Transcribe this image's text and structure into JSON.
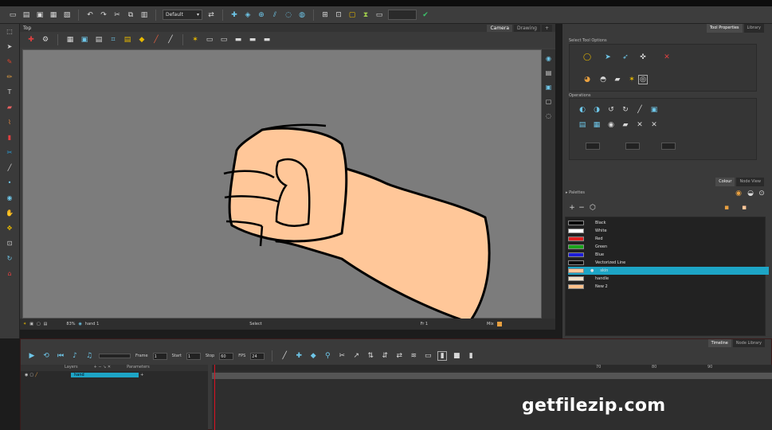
{
  "window": {
    "view_title": "Top",
    "view_tabs": [
      "Camera",
      "Drawing"
    ],
    "toolbar_preset": "Default"
  },
  "statusbar": {
    "zoom": "83%",
    "layer": "hand 1",
    "tool": "Select",
    "frame": "Fr 1",
    "mode": "Mix"
  },
  "tool_properties": {
    "tabs": [
      "Tool Properties",
      "Library"
    ],
    "select_options_label": "Select Tool Options",
    "operations_label": "Operations"
  },
  "colour": {
    "tabs": [
      "Colour",
      "Node View"
    ],
    "palettes_label": "Palettes",
    "swatches": [
      {
        "name": "Black",
        "color": "#000000",
        "selected": false
      },
      {
        "name": "White",
        "color": "#ffffff",
        "selected": false
      },
      {
        "name": "Red",
        "color": "#e02020",
        "selected": false
      },
      {
        "name": "Green",
        "color": "#1aa61a",
        "selected": false
      },
      {
        "name": "Blue",
        "color": "#1c1cd8",
        "selected": false
      },
      {
        "name": "Vectorized Line",
        "color": "#0a0a0a",
        "selected": false
      },
      {
        "name": "skin",
        "color": "#ffc799",
        "selected": true
      },
      {
        "name": "handle",
        "color": "#f0e0c8",
        "selected": false
      },
      {
        "name": "New 2",
        "color": "#ffc08a",
        "selected": false
      }
    ]
  },
  "timeline": {
    "tabs": [
      "Timeline",
      "Node Library"
    ],
    "frame_label": "Frame",
    "frame_value": "1",
    "start_label": "Start",
    "start_value": "1",
    "stop_label": "Stop",
    "stop_value": "60",
    "fps_label": "FPS",
    "fps_value": "24",
    "layers_header": "Layers",
    "parameters_header": "Parameters",
    "layer_name": "hand",
    "ruler_marks": [
      "70",
      "80",
      "90"
    ]
  },
  "watermark": "getfilezip.com",
  "colors": {
    "selection_highlight": "#1da5c6",
    "skin": "#ffc799",
    "canvas_bg": "#7c7c7c"
  }
}
